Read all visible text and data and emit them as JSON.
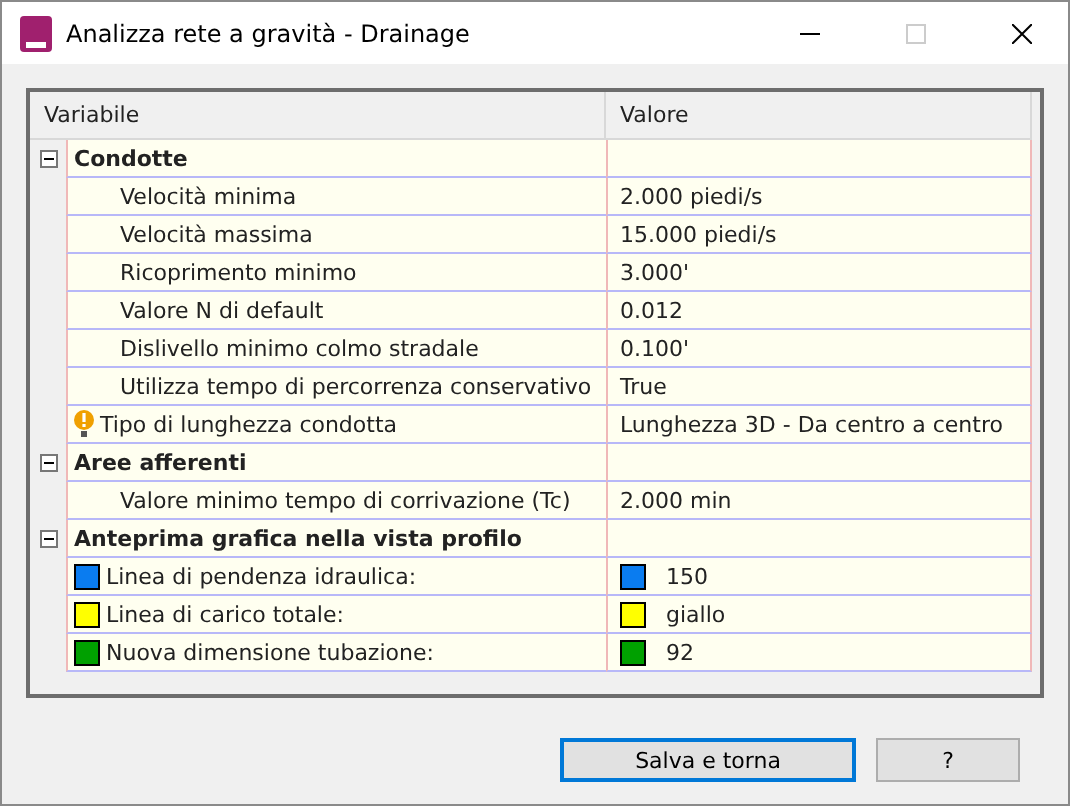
{
  "window": {
    "title": "Analizza rete a gravità - Drainage"
  },
  "table": {
    "columns": [
      "Variabile",
      "Valore"
    ],
    "groups": [
      {
        "label": "Condotte",
        "expanded": true,
        "rows": [
          {
            "kind": "text",
            "label": "Velocità minima",
            "value": "2.000 piedi/s"
          },
          {
            "kind": "text",
            "label": "Velocità massima",
            "value": "15.000 piedi/s"
          },
          {
            "kind": "text",
            "label": "Ricoprimento minimo",
            "value": "3.000'"
          },
          {
            "kind": "text",
            "label": "Valore N di default",
            "value": "0.012"
          },
          {
            "kind": "text",
            "label": "Dislivello minimo colmo stradale",
            "value": "0.100'"
          },
          {
            "kind": "text",
            "label": "Utilizza tempo di percorrenza conservativo",
            "value": "True"
          },
          {
            "kind": "warning",
            "label": "Tipo di lunghezza condotta",
            "value": "Lunghezza 3D - Da centro a centro"
          }
        ]
      },
      {
        "label": "Aree afferenti",
        "expanded": true,
        "rows": [
          {
            "kind": "text",
            "label": "Valore minimo tempo di corrivazione (Tc)",
            "value": "2.000 min"
          }
        ]
      },
      {
        "label": "Anteprima grafica nella vista profilo",
        "expanded": true,
        "rows": [
          {
            "kind": "color",
            "label": "Linea di pendenza idraulica:",
            "value": "150",
            "color": "#0a7cf0"
          },
          {
            "kind": "color",
            "label": "Linea di carico totale:",
            "value": "giallo",
            "color": "#ffff00"
          },
          {
            "kind": "color",
            "label": "Nuova dimensione tubazione:",
            "value": "92",
            "color": "#00a000"
          }
        ]
      }
    ]
  },
  "buttons": [
    {
      "label": "Salva e torna",
      "default": true
    },
    {
      "label": "?",
      "default": false
    }
  ]
}
